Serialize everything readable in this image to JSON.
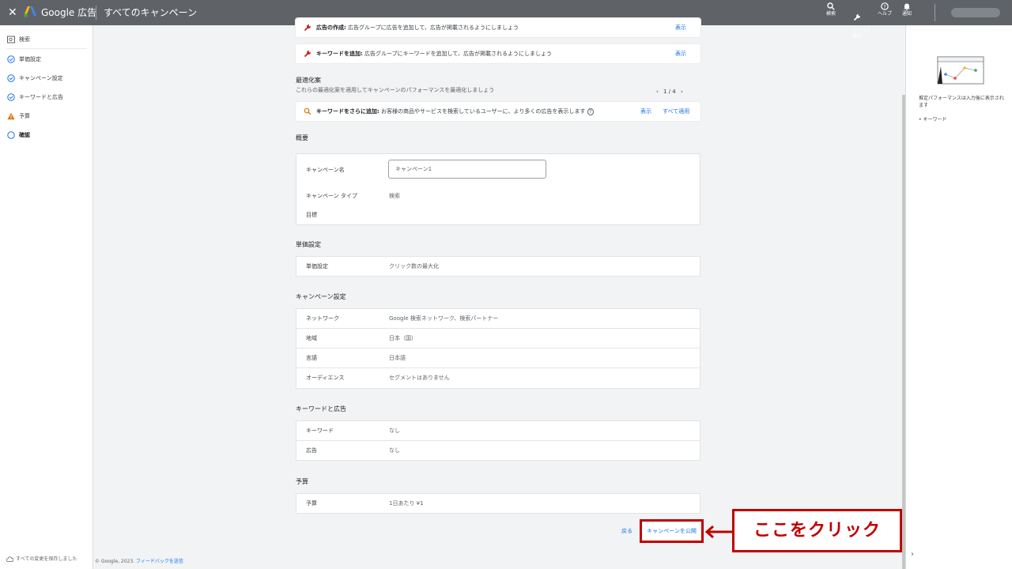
{
  "header": {
    "close_icon": "close-icon",
    "brand": "Google 広告",
    "title": "すべてのキャンペーン",
    "tools": [
      {
        "label": "検索",
        "icon": "search-icon"
      },
      {
        "label": "ツールと\n設定",
        "icon": "wrench-icon"
      },
      {
        "label": "ヘルプ",
        "icon": "help-icon"
      },
      {
        "label": "通知",
        "icon": "bell-icon"
      }
    ]
  },
  "sidebar": {
    "items": [
      {
        "label": "検索",
        "icon": "search-campaign-icon"
      },
      {
        "label": "単価設定",
        "icon": "check-circle-icon"
      },
      {
        "label": "キャンペーン設定",
        "icon": "check-circle-icon"
      },
      {
        "label": "キーワードと広告",
        "icon": "check-circle-icon"
      },
      {
        "label": "予算",
        "icon": "warning-icon"
      },
      {
        "label": "確認",
        "icon": "circle-icon"
      }
    ],
    "saved": "すべての変更を保存しました"
  },
  "footer": {
    "copyright": "© Google, 2023.",
    "feedback": "フィードバックを送信"
  },
  "tips": [
    {
      "bold": "広告の作成:",
      "text": " 広告グループに広告を追加して、広告が掲載されるようにしましょう",
      "link": "表示"
    },
    {
      "bold": "キーワードを追加:",
      "text": " 広告グループにキーワードを追加して、広告が掲載されるようにしましょう",
      "link": "表示"
    }
  ],
  "optimization": {
    "title": "最適化案",
    "subtitle": "これらの最適化案を適用してキャンペーンのパフォーマンスを最適化しましょう",
    "pager": "1 / 4",
    "tip_bold": "キーワードをさらに追加:",
    "tip_text": " お客様の商品やサービスを検索しているユーザーに、より多くの広告を表示します",
    "view": "表示",
    "apply_all": "すべて適用"
  },
  "overview": {
    "title": "概要",
    "name_label": "キャンペーン名",
    "name_value": "キャンペーン1",
    "type_label": "キャンペーン タイプ",
    "type_value": "検索",
    "goal_label": "目標"
  },
  "bidding": {
    "title": "単価設定",
    "label": "単価設定",
    "value": "クリック数の最大化"
  },
  "campaign_settings": {
    "title": "キャンペーン設定",
    "rows": [
      {
        "k": "ネットワーク",
        "v": "Google 検索ネットワーク、検索パートナー"
      },
      {
        "k": "地域",
        "v": "日本（国）"
      },
      {
        "k": "言語",
        "v": "日本語"
      },
      {
        "k": "オーディエンス",
        "v": "セグメントはありません"
      }
    ]
  },
  "keywords_ads": {
    "title": "キーワードと広告",
    "rows": [
      {
        "k": "キーワード",
        "v": "なし"
      },
      {
        "k": "広告",
        "v": "なし"
      }
    ]
  },
  "budget": {
    "title": "予算",
    "label": "予算",
    "value": "1日あたり ¥1"
  },
  "actions": {
    "back": "戻る",
    "publish": "キャンペーンを公開"
  },
  "callout": "ここをクリック",
  "right_panel": {
    "text": "推定パフォーマンスは入力後に表示されます",
    "bullet": "• キーワード"
  }
}
